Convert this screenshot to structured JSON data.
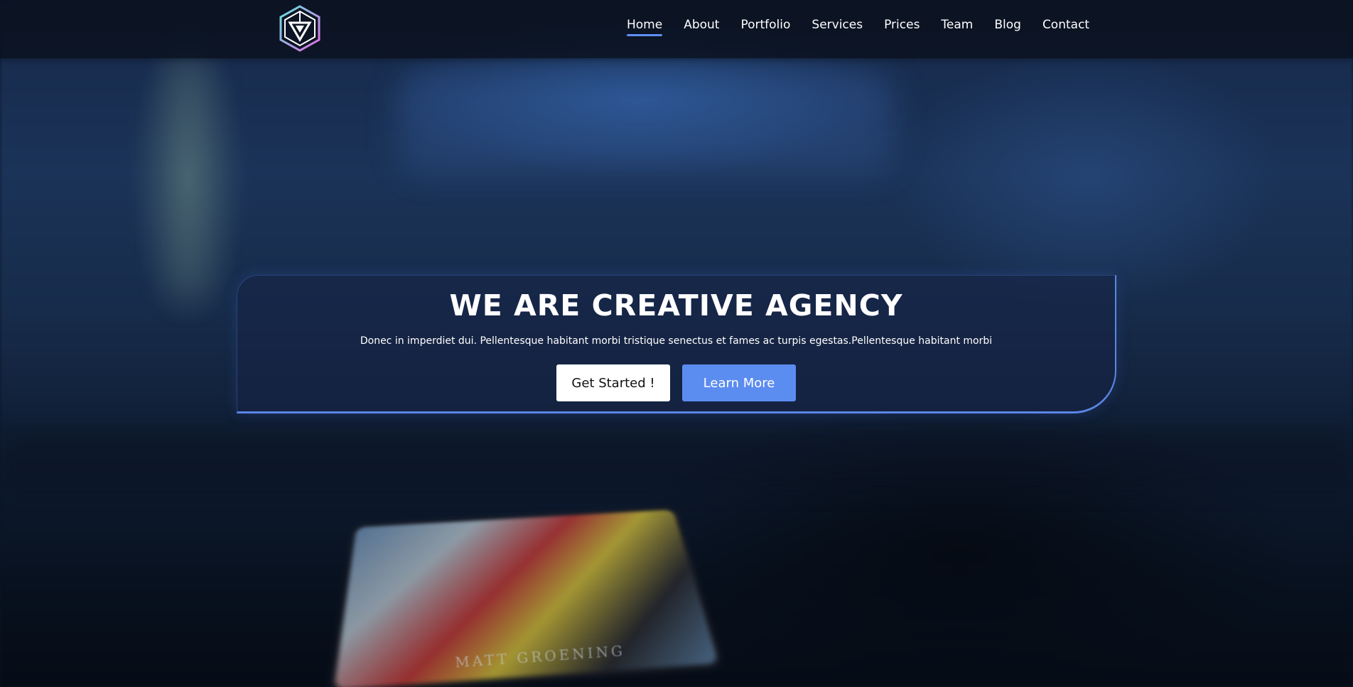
{
  "header": {
    "logo_icon": "hexagon-triangle-logo-icon",
    "nav": [
      {
        "label": "Home",
        "active": true
      },
      {
        "label": "About",
        "active": false
      },
      {
        "label": "Portfolio",
        "active": false
      },
      {
        "label": "Services",
        "active": false
      },
      {
        "label": "Prices",
        "active": false
      },
      {
        "label": "Team",
        "active": false
      },
      {
        "label": "Blog",
        "active": false
      },
      {
        "label": "Contact",
        "active": false
      }
    ]
  },
  "hero": {
    "title": "WE ARE CREATIVE AGENCY",
    "subtitle": "Donec in imperdiet dui. Pellentesque habitant morbi tristique senectus et fames ac turpis egestas.Pellentesque habitant morbi",
    "primary_button": "Get Started !",
    "secondary_button": "Learn More"
  },
  "background": {
    "card_text": "MATT GROENING"
  },
  "colors": {
    "accent": "#5b8cf0",
    "header_bg": "#0a101c",
    "hero_border": "#5b86e4"
  }
}
